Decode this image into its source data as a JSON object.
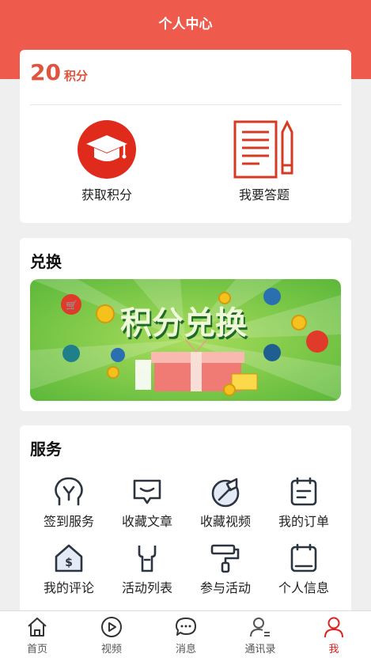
{
  "header": {
    "title": "个人中心"
  },
  "points": {
    "value": "20",
    "unit": "积分",
    "actions": [
      {
        "label": "获取积分",
        "icon": "graduation-cap-icon"
      },
      {
        "label": "我要答题",
        "icon": "document-pencil-icon"
      }
    ]
  },
  "exchange": {
    "title": "兑换",
    "banner_text": "积分兑换"
  },
  "services": {
    "title": "服务",
    "items": [
      {
        "label": "签到服务",
        "icon": "badge-icon"
      },
      {
        "label": "收藏文章",
        "icon": "message-box-icon"
      },
      {
        "label": "收藏视频",
        "icon": "wrench-circle-icon"
      },
      {
        "label": "我的订单",
        "icon": "clipboard-icon"
      },
      {
        "label": "我的评论",
        "icon": "house-dollar-icon"
      },
      {
        "label": "活动列表",
        "icon": "spanner-icon"
      },
      {
        "label": "参与活动",
        "icon": "paint-roller-icon"
      },
      {
        "label": "个人信息",
        "icon": "notebook-icon"
      }
    ]
  },
  "tabbar": {
    "active_color": "#e02020",
    "items": [
      {
        "label": "首页",
        "icon": "home-icon"
      },
      {
        "label": "视频",
        "icon": "play-circle-icon"
      },
      {
        "label": "消息",
        "icon": "chat-bubble-icon"
      },
      {
        "label": "通讯录",
        "icon": "contacts-icon"
      },
      {
        "label": "我",
        "icon": "user-icon"
      }
    ]
  },
  "colors": {
    "brand": "#ee5a4b",
    "accent_text": "#e0533f",
    "icon_accent": "#e63b2e"
  }
}
